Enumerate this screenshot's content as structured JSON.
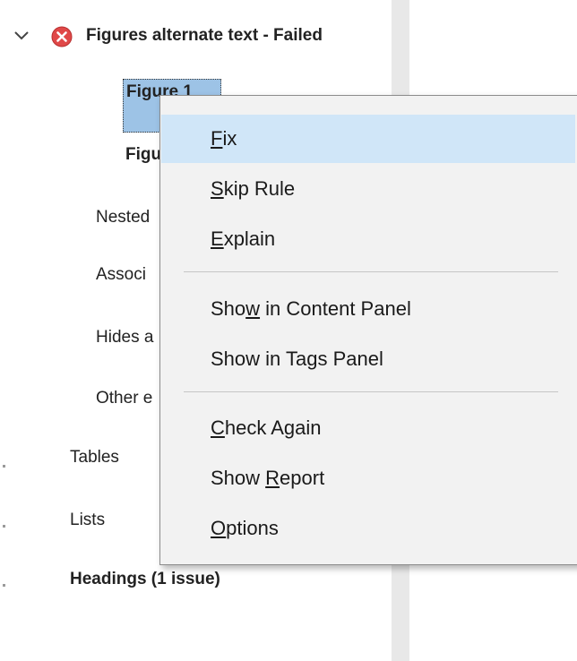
{
  "tree": {
    "heading": "Figures alternate text - Failed",
    "children": [
      "Figure 1",
      "Figu",
      "Nested",
      "Associ",
      "Hides a",
      "Other e"
    ],
    "sections": [
      "Tables",
      "Lists",
      "Headings (1 issue)"
    ]
  },
  "menu": {
    "items": [
      {
        "before": "",
        "key": "F",
        "after": "ix"
      },
      {
        "before": "",
        "key": "S",
        "after": "kip Rule"
      },
      {
        "before": "",
        "key": "E",
        "after": "xplain"
      },
      {
        "before": "Sho",
        "key": "w",
        "after": " in Content Panel"
      },
      {
        "before": "Show in Ta",
        "key": "g",
        "after": "s Panel"
      },
      {
        "before": "",
        "key": "C",
        "after": "heck Again"
      },
      {
        "before": "Show ",
        "key": "R",
        "after": "eport"
      },
      {
        "before": "",
        "key": "O",
        "after": "ptions"
      }
    ]
  },
  "colors": {
    "selection": "#9dc3e6",
    "menu_highlight": "#d0e6f8",
    "fail_icon": "#e04848",
    "menu_background": "#f2f2f2"
  },
  "icons": {
    "expand": "chevron-down-icon",
    "status": "error-x-icon"
  }
}
